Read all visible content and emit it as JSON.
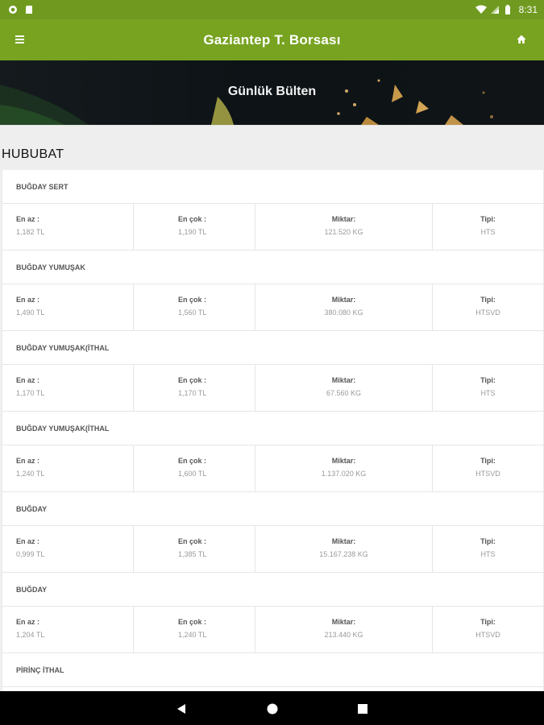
{
  "status_bar": {
    "time": "8:31"
  },
  "app_bar": {
    "title": "Gaziantep T. Borsası"
  },
  "banner": {
    "title": "Günlük Bülten"
  },
  "section": {
    "title": "HUBUBAT"
  },
  "labels": {
    "min": "En az :",
    "max": "En çok :",
    "qty": "Miktar:",
    "type": "Tipi:"
  },
  "items": [
    {
      "name": "BUĞDAY SERT",
      "min": "1,182 TL",
      "max": "1,190 TL",
      "qty": "121.520 KG",
      "type": "HTS"
    },
    {
      "name": "BUĞDAY YUMUŞAK",
      "min": "1,490 TL",
      "max": "1,560 TL",
      "qty": "380.080 KG",
      "type": "HTSVD"
    },
    {
      "name": "BUĞDAY YUMUŞAK(İTHAL",
      "min": "1,170 TL",
      "max": "1,170 TL",
      "qty": "67.560 KG",
      "type": "HTS"
    },
    {
      "name": "BUĞDAY YUMUŞAK(İTHAL",
      "min": "1,240 TL",
      "max": "1,600 TL",
      "qty": "1.137.020 KG",
      "type": "HTSVD"
    },
    {
      "name": "BUĞDAY",
      "min": "0,999 TL",
      "max": "1,385 TL",
      "qty": "15.167.238 KG",
      "type": "HTS"
    },
    {
      "name": "BUĞDAY",
      "min": "1,204 TL",
      "max": "1,240 TL",
      "qty": "213.440 KG",
      "type": "HTSVD"
    },
    {
      "name": "PİRİNÇ İTHAL"
    }
  ],
  "colors": {
    "status_bar": "#6f9a1f",
    "app_bar": "#77a321",
    "nav_bar": "#000000"
  },
  "icons": {
    "menu": "hamburger-icon",
    "home": "home-icon",
    "back": "back-triangle-icon",
    "home_nav": "circle-icon",
    "recents": "square-icon"
  }
}
